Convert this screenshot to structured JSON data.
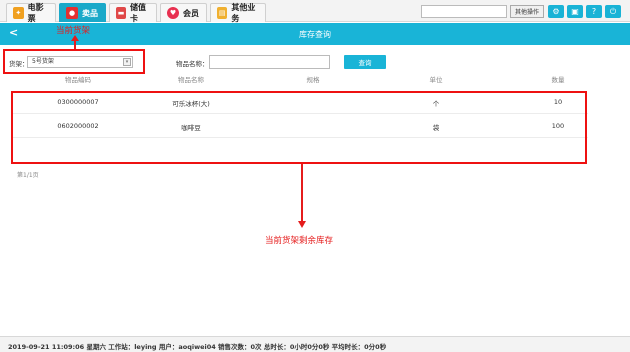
{
  "tabs": [
    {
      "label": "电影票",
      "icon": "movie-ticket-icon",
      "color": "#f0a020"
    },
    {
      "label": "卖品",
      "icon": "popcorn-icon",
      "color": "#e53030"
    },
    {
      "label": "储值卡",
      "icon": "card-icon",
      "color": "#e04848"
    },
    {
      "label": "会员",
      "icon": "heart-icon",
      "color": "#e83050"
    },
    {
      "label": "其他业务",
      "icon": "clipboard-icon",
      "color": "#f0b030"
    }
  ],
  "toolbar": {
    "other_ops_label": "其他操作"
  },
  "header": {
    "title": "库存查询",
    "back": "<"
  },
  "filter": {
    "shelf_label": "货架：",
    "shelf_value": "5号货架",
    "name_label": "物品名称：",
    "name_value": "",
    "query_label": "查询"
  },
  "table": {
    "columns": [
      "物品编码",
      "物品名称",
      "规格",
      "单位",
      "数量"
    ],
    "rows": [
      [
        "0300000007",
        "可乐冰杯(大)",
        "",
        "个",
        "10"
      ],
      [
        "0602000002",
        "咖啡豆",
        "",
        "袋",
        "100"
      ]
    ]
  },
  "pager": {
    "text": "第1/1页"
  },
  "annotations": {
    "current_shelf": "当前货架",
    "remaining_stock": "当前货架剩余库存"
  },
  "status": {
    "text": "2019-09-21 11:09:06 星期六   工作站：leying   用户：aoqiwei04   销售次数：0次   总时长：0小时0分0秒   平均时长：0分0秒"
  },
  "colors": {
    "accent": "#19b4d7",
    "annotation": "#e51c1c"
  }
}
